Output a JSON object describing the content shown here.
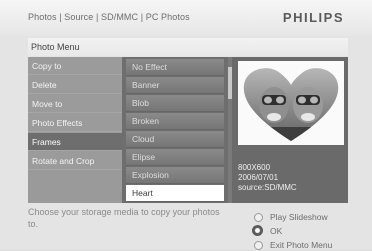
{
  "header": {
    "breadcrumb": "Photos | Source | SD/MMC | PC Photos",
    "brand": "PHILIPS"
  },
  "menu": {
    "title": "Photo Menu",
    "items": [
      {
        "label": "Copy to"
      },
      {
        "label": "Delete"
      },
      {
        "label": "Move to"
      },
      {
        "label": "Photo Effects"
      },
      {
        "label": "Frames",
        "selected": true
      },
      {
        "label": "Rotate and Crop"
      }
    ]
  },
  "frames": {
    "items": [
      {
        "label": "No Effect"
      },
      {
        "label": "Banner"
      },
      {
        "label": "Blob"
      },
      {
        "label": "Broken"
      },
      {
        "label": "Cloud"
      },
      {
        "label": "Elipse"
      },
      {
        "label": "Explosion"
      },
      {
        "label": "Heart",
        "selected": true
      }
    ]
  },
  "photo_info": {
    "resolution": "800X600",
    "date": "2006/07/01",
    "source": "source:SD/MMC"
  },
  "footer": {
    "hint": "Choose your storage media to copy your photos to.",
    "options": [
      {
        "label": "Play Slideshow",
        "active": false
      },
      {
        "label": "OK",
        "active": true
      },
      {
        "label": "Exit Photo Menu",
        "active": false
      }
    ]
  },
  "colors": {
    "selected_menu": "#6e6e6e",
    "selected_frame": "#ffffff",
    "background": "#e4e4e4"
  }
}
